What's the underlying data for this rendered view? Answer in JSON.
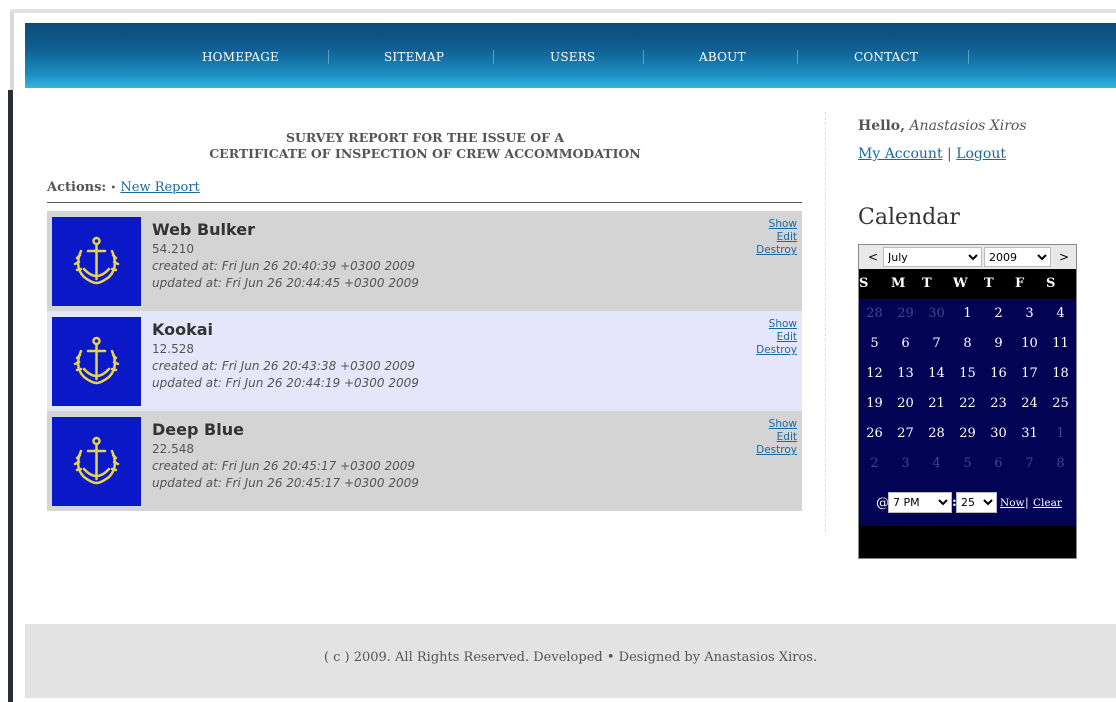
{
  "nav": {
    "items": [
      "HOMEPAGE",
      "SITEMAP",
      "USERS",
      "ABOUT",
      "CONTACT"
    ]
  },
  "page": {
    "title_line1": "SURVEY REPORT FOR THE ISSUE OF A",
    "title_line2": "CERTIFICATE OF INSPECTION OF CREW ACCOMMODATION",
    "actions_label": "Actions:",
    "actions_sep": "•",
    "new_report": "New Report"
  },
  "records": [
    {
      "name": "Web Bulker",
      "tonnage": "54.210",
      "created": "created at: Fri Jun 26 20:40:39 +0300 2009",
      "updated": "updated at: Fri Jun 26 20:44:45 +0300 2009"
    },
    {
      "name": "Kookai",
      "tonnage": "12.528",
      "created": "created at: Fri Jun 26 20:43:38 +0300 2009",
      "updated": "updated at: Fri Jun 26 20:44:19 +0300 2009"
    },
    {
      "name": "Deep Blue",
      "tonnage": "22.548",
      "created": "created at: Fri Jun 26 20:45:17 +0300 2009",
      "updated": "updated at: Fri Jun 26 20:45:17 +0300 2009"
    }
  ],
  "record_links": {
    "show": "Show",
    "edit": "Edit",
    "destroy": "Destroy"
  },
  "colors": {
    "row_odd": "#d4d4d4",
    "row_even": "#e6e6fa",
    "flag_bg": "#0a18c8",
    "emblem": "#e8d44a"
  },
  "sidebar": {
    "hello": "Hello,",
    "user": "Anastasios Xiros",
    "my_account": "My Account",
    "sep": "|",
    "logout": "Logout",
    "calendar_title": "Calendar"
  },
  "calendar": {
    "prev": "<",
    "next": ">",
    "month": "July",
    "year": "2009",
    "dow": [
      "S",
      "M",
      "T",
      "W",
      "T",
      "F",
      "S"
    ],
    "weeks": [
      [
        [
          "28",
          true
        ],
        [
          "29",
          true
        ],
        [
          "30",
          true
        ],
        [
          "1",
          false
        ],
        [
          "2",
          false
        ],
        [
          "3",
          false
        ],
        [
          "4",
          false
        ]
      ],
      [
        [
          "5",
          false
        ],
        [
          "6",
          false
        ],
        [
          "7",
          false
        ],
        [
          "8",
          false
        ],
        [
          "9",
          false
        ],
        [
          "10",
          false
        ],
        [
          "11",
          false
        ]
      ],
      [
        [
          "12",
          false
        ],
        [
          "13",
          false
        ],
        [
          "14",
          false
        ],
        [
          "15",
          false
        ],
        [
          "16",
          false
        ],
        [
          "17",
          false
        ],
        [
          "18",
          false
        ]
      ],
      [
        [
          "19",
          false
        ],
        [
          "20",
          false
        ],
        [
          "21",
          false
        ],
        [
          "22",
          false
        ],
        [
          "23",
          false
        ],
        [
          "24",
          false
        ],
        [
          "25",
          false
        ]
      ],
      [
        [
          "26",
          false
        ],
        [
          "27",
          false
        ],
        [
          "28",
          false
        ],
        [
          "29",
          false
        ],
        [
          "30",
          false
        ],
        [
          "31",
          false
        ],
        [
          "1",
          true
        ]
      ],
      [
        [
          "2",
          true
        ],
        [
          "3",
          true
        ],
        [
          "4",
          true
        ],
        [
          "5",
          true
        ],
        [
          "6",
          true
        ],
        [
          "7",
          true
        ],
        [
          "8",
          true
        ]
      ]
    ],
    "at": "@",
    "hour": "7 PM",
    "colon": ":",
    "minute": "25",
    "now": "Now",
    "pipe": "|",
    "clear": "Clear"
  },
  "footer": {
    "text": "( c ) 2009. All Rights Reserved. Developed • Designed by Anastasios Xiros."
  }
}
